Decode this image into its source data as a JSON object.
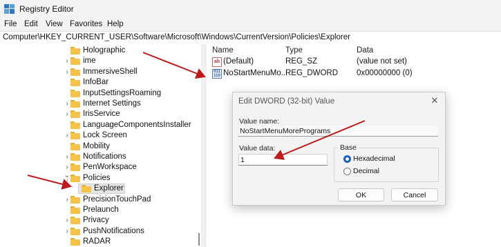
{
  "window": {
    "title": "Registry Editor"
  },
  "menu": [
    "File",
    "Edit",
    "View",
    "Favorites",
    "Help"
  ],
  "address": "Computer\\HKEY_CURRENT_USER\\Software\\Microsoft\\Windows\\CurrentVersion\\Policies\\Explorer",
  "tree": {
    "items": [
      {
        "label": "Holographic",
        "expandable": false
      },
      {
        "label": "ime",
        "expandable": true
      },
      {
        "label": "ImmersiveShell",
        "expandable": true
      },
      {
        "label": "InfoBar",
        "expandable": false
      },
      {
        "label": "InputSettingsRoaming",
        "expandable": false
      },
      {
        "label": "Internet Settings",
        "expandable": true
      },
      {
        "label": "IrisService",
        "expandable": true
      },
      {
        "label": "LanguageComponentsInstaller",
        "expandable": false
      },
      {
        "label": "Lock Screen",
        "expandable": true
      },
      {
        "label": "Mobility",
        "expandable": false
      },
      {
        "label": "Notifications",
        "expandable": true
      },
      {
        "label": "PenWorkspace",
        "expandable": true
      },
      {
        "label": "Policies",
        "expandable": true,
        "expanded": true
      },
      {
        "label": "Explorer",
        "expandable": false,
        "selected": true,
        "child": true
      },
      {
        "label": "PrecisionTouchPad",
        "expandable": true
      },
      {
        "label": "Prelaunch",
        "expandable": false
      },
      {
        "label": "Privacy",
        "expandable": true
      },
      {
        "label": "PushNotifications",
        "expandable": true
      },
      {
        "label": "RADAR",
        "expandable": false
      }
    ]
  },
  "values_pane": {
    "headers": {
      "name": "Name",
      "type": "Type",
      "data": "Data"
    },
    "rows": [
      {
        "name": "(Default)",
        "type": "REG_SZ",
        "data": "(value not set)",
        "icon": "string-value-icon"
      },
      {
        "name": "NoStartMenuMo...",
        "type": "REG_DWORD",
        "data": "0x00000000 (0)",
        "icon": "dword-value-icon"
      }
    ]
  },
  "dialog": {
    "title": "Edit DWORD (32-bit) Value",
    "value_name_label": "Value name:",
    "value_name": "NoStartMenuMorePrograms",
    "value_data_label": "Value data:",
    "value_data": "1",
    "base_label": "Base",
    "hex_label": "Hexadecimal",
    "dec_label": "Decimal",
    "base_selected": "Hexadecimal",
    "ok_label": "OK",
    "cancel_label": "Cancel"
  },
  "colors": {
    "folder": "#f5c349",
    "arrow": "#c0191b",
    "radio_accent": "#1b5fbd"
  }
}
